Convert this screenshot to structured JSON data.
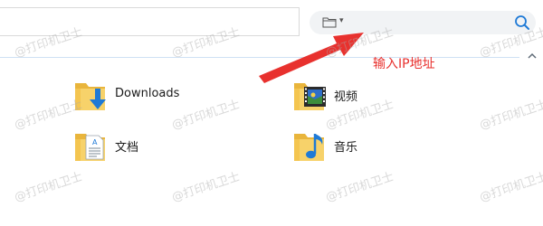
{
  "search": {
    "placeholder": "",
    "value": ""
  },
  "annotation": {
    "text": "输入IP地址",
    "color": "#e8312e"
  },
  "folders": [
    {
      "label": "Downloads",
      "icon": "downloads-folder-icon"
    },
    {
      "label": "视频",
      "icon": "videos-folder-icon"
    },
    {
      "label": "文档",
      "icon": "documents-folder-icon"
    },
    {
      "label": "音乐",
      "icon": "music-folder-icon"
    }
  ],
  "watermark": {
    "text": "@打印机卫士"
  },
  "colors": {
    "folder_yellow": "#f4c550",
    "accent_blue": "#1f7ad6",
    "divider": "#cfe1f4",
    "arrow_red": "#e8312e"
  }
}
